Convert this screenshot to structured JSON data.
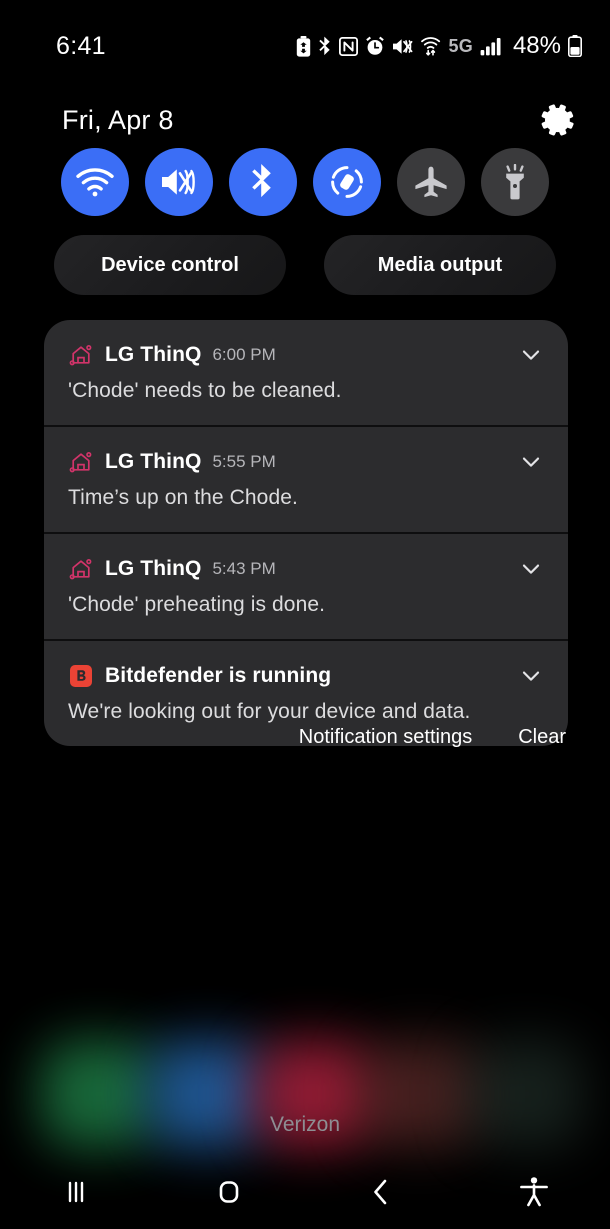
{
  "status_bar": {
    "time": "6:41",
    "battery_percent": "48%",
    "network_type": "5G",
    "icons": [
      "battery-saver-icon",
      "bluetooth-icon",
      "nfc-icon",
      "alarm-icon",
      "mute-vibrate-icon",
      "wifi-calling-icon",
      "signal-bars-icon",
      "battery-icon"
    ]
  },
  "header": {
    "date": "Fri, Apr 8",
    "settings_icon": "gear-icon"
  },
  "quick_settings": {
    "toggles": [
      {
        "name": "wifi",
        "label": "Wi-Fi",
        "icon": "wifi-icon",
        "state": "on"
      },
      {
        "name": "sound-mode",
        "label": "Vibrate",
        "icon": "mute-vibrate-icon",
        "state": "on"
      },
      {
        "name": "bluetooth",
        "label": "Bluetooth",
        "icon": "bluetooth-icon",
        "state": "on"
      },
      {
        "name": "auto-rotate",
        "label": "Auto rotate",
        "icon": "auto-rotate-icon",
        "state": "on"
      },
      {
        "name": "airplane-mode",
        "label": "Airplane mode",
        "icon": "airplane-icon",
        "state": "off"
      },
      {
        "name": "flashlight",
        "label": "Flashlight",
        "icon": "flashlight-icon",
        "state": "off"
      }
    ],
    "accent_on_color": "#3b6ef6",
    "accent_off_color": "#3a3a3c"
  },
  "shortcuts": {
    "device_control": "Device control",
    "media_output": "Media output"
  },
  "notifications": [
    {
      "app": "LG ThinQ",
      "time": "6:00 PM",
      "body": "'Chode' needs to be cleaned.",
      "icon": "lg-thinq-home-icon",
      "icon_color": "#d2346a"
    },
    {
      "app": "LG ThinQ",
      "time": "5:55 PM",
      "body": "Time’s up on the Chode.",
      "icon": "lg-thinq-home-icon",
      "icon_color": "#d2346a"
    },
    {
      "app": "LG ThinQ",
      "time": "5:43 PM",
      "body": "'Chode' preheating is done.",
      "icon": "lg-thinq-home-icon",
      "icon_color": "#d2346a"
    },
    {
      "app": "Bitdefender is running",
      "time": "",
      "body": "We're looking out for your device and data.",
      "icon": "bitdefender-icon",
      "icon_color": "#ea4335"
    }
  ],
  "notification_actions": {
    "settings_label": "Notification settings",
    "clear_label": "Clear"
  },
  "home_screen": {
    "carrier": "Verizon",
    "glow_colors": [
      "#1d7a44",
      "#2463a8",
      "#a8203c",
      "#7c3a38",
      "#2c4038"
    ]
  },
  "navigation_bar": {
    "buttons": [
      {
        "name": "recents",
        "icon": "recents-icon"
      },
      {
        "name": "home",
        "icon": "home-icon"
      },
      {
        "name": "back",
        "icon": "back-chevron-icon"
      },
      {
        "name": "accessibility",
        "icon": "accessibility-icon"
      }
    ]
  }
}
